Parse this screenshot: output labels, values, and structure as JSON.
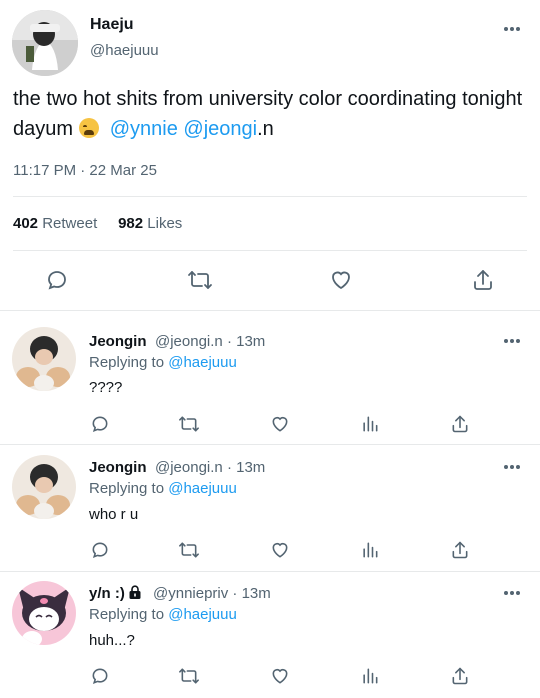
{
  "main_tweet": {
    "name": "Haeju",
    "handle": "@haejuuu",
    "text_before": "the two hot shits from university color coordinating tonight dayum ",
    "mention_1": "@ynnie",
    "mention_2": "@jeongi",
    "text_after": ".n",
    "timestamp": "11:17 PM · 22 Mar 25",
    "retweet_count": "402",
    "retweet_label": "Retweet",
    "like_count": "982",
    "like_label": "Likes"
  },
  "replies": [
    {
      "name": "Jeongin",
      "meta": "@jeongi.n · 13m",
      "replying_prefix": "Replying to ",
      "replying_to": "@haejuuu",
      "text": "????"
    },
    {
      "name": "Jeongin",
      "meta": "@jeongi.n · 13m",
      "replying_prefix": "Replying to ",
      "replying_to": "@haejuuu",
      "text": "who r u"
    },
    {
      "name": "y/n :)",
      "meta": "@ynniepriv · 13m",
      "replying_prefix": "Replying to ",
      "replying_to": "@haejuuu",
      "text": "huh...?"
    }
  ],
  "colors": {
    "accent": "#1d9bf0",
    "secondary_text": "#536471",
    "divider": "#e7e9ea"
  },
  "icons": {
    "reply": "comment-icon",
    "retweet": "retweet-icon",
    "like": "heart-icon",
    "share": "share-icon",
    "views": "analytics-icon",
    "lock": "lock-icon",
    "more": "more-dots-icon"
  }
}
